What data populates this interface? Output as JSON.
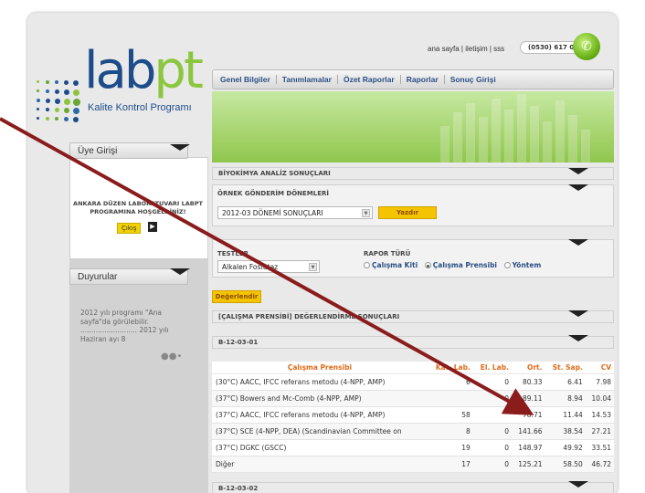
{
  "logo": {
    "part1": "lab",
    "part2": "pt",
    "subtitle": "Kalite Kontrol Programı"
  },
  "top_links": "ana sayfa | iletişim | sss",
  "phone": "(0530) 617 02 88",
  "nav": [
    "Genel Bilgiler",
    "Tanımlamalar",
    "Özet Raporlar",
    "Raporlar",
    "Sonuç Girişi"
  ],
  "sidebar": {
    "login_title": "Üye Girişi",
    "welcome": "ANKARA DÜZEN LABORATUVARI LABPT PROGRAMINA HOŞGELDİNİZ!",
    "logout": "Çıkış",
    "news_title": "Duyurular",
    "news_text": "2012 yılı programı \"Ana sayfa\"da görülebilir. .......................... 2012 yılı Haziran ayı 8"
  },
  "section_biyo": "BİYOKİMYA ANALİZ SONUÇLARI",
  "periods": {
    "label": "ÖRNEK GÖNDERİM DÖNEMLERİ",
    "selected": "2012-03 DÖNEMİ SONUÇLARI",
    "print_button": "Yazdır"
  },
  "tests": {
    "label": "TESTLER",
    "selected": "Alkalen Fosfataz",
    "report_type_label": "RAPOR TÜRÜ",
    "options": [
      "Çalışma Kiti",
      "Çalışma Prensibi",
      "Yöntem"
    ],
    "selected_option": "Çalışma Prensibi"
  },
  "evaluate_button": "Değerlendir",
  "results_title": "[ÇALIŞMA PRENSİBİ] DEĞERLENDİRME SONUÇLARI",
  "group1_title": "B-12-03-01",
  "group2_title": "B-12-03-02",
  "table": {
    "headers": [
      "Çalışma Prensibi",
      "Kat. Lab.",
      "El. Lab.",
      "Ort.",
      "St. Sap.",
      "CV"
    ],
    "rows": [
      [
        "(30°C) AACC, IFCC referans metodu (4-NPP, AMP)",
        "6",
        "0",
        "80.33",
        "6.41",
        "7.98"
      ],
      [
        "(37°C) Bowers and Mc-Comb (4-NPP, AMP)",
        "",
        "0",
        "89.11",
        "8.94",
        "10.04"
      ],
      [
        "(37°C) AACC, IFCC referans metodu (4-NPP, AMP)",
        "58",
        "",
        "78.71",
        "11.44",
        "14.53"
      ],
      [
        "(37°C) SCE (4-NPP, DEA) (Scandinavian Committee on",
        "8",
        "0",
        "141.66",
        "38.54",
        "27.21"
      ],
      [
        "(37°C) DGKC (GSCC)",
        "19",
        "0",
        "148.97",
        "49.92",
        "33.51"
      ],
      [
        "Diğer",
        "17",
        "0",
        "125.21",
        "58.50",
        "46.72"
      ]
    ]
  }
}
